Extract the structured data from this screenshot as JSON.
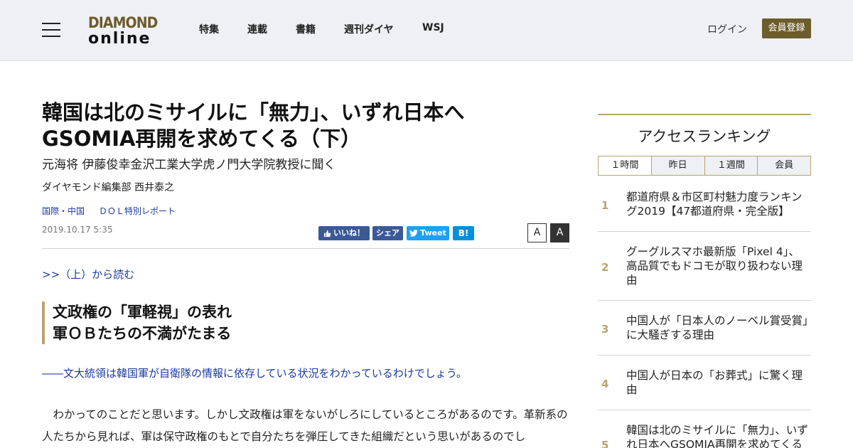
{
  "header": {
    "logo_top": "DIAMOND",
    "logo_bottom": "online",
    "nav": [
      "特集",
      "連載",
      "書籍",
      "週刊ダイヤ",
      "WSJ"
    ],
    "login": "ログイン",
    "register": "会員登録",
    "brand_color": "#6d5c2c"
  },
  "article": {
    "title_line1": "韓国は北のミサイルに「無力」、いずれ日本へ",
    "title_line2": "GSOMIA再開を求めてくる（下）",
    "subtitle": "元海将 伊藤俊幸金沢工業大学虎ノ門大学院教授に聞く",
    "author": "ダイヤモンド編集部 西井泰之",
    "categories": [
      "国際・中国",
      "ＤＯＬ特別レポート"
    ],
    "date": "2019.10.17 5:35",
    "share": {
      "like": "いいね！",
      "share": "シェア",
      "tweet": "Tweet",
      "hatena": "B!"
    },
    "font_small": "A",
    "font_large": "A",
    "prev_link": ">>（上）から読む",
    "section_line1": "文政権の「軍軽視」の表れ",
    "section_line2": "軍ＯＢたちの不満がたまる",
    "question": "――文大統領は韓国軍が自衛隊の情報に依存している状況をわかっているわけでしょう。",
    "body": "わかってのことだと思います。しかし文政権は軍をないがしろにしているところがあるのです。革新系の人たちから見れば、軍は保守政権のもとで自分たちを弾圧してきた組織だという思いがあるのでし"
  },
  "sidebar": {
    "title": "アクセスランキング",
    "tabs": [
      "１時間",
      "昨日",
      "１週間",
      "会員"
    ],
    "items": [
      {
        "rank": "1",
        "text": "都道府県＆市区町村魅力度ランキング2019【47都道府県・完全版】"
      },
      {
        "rank": "2",
        "text": "グーグルスマホ最新版「Pixel 4」、高品質でもドコモが取り扱わない理由"
      },
      {
        "rank": "3",
        "text": "中国人が「日本人のノーベル賞受賞」に大騒ぎする理由"
      },
      {
        "rank": "4",
        "text": "中国人が日本の「お葬式」に驚く理由"
      },
      {
        "rank": "5",
        "text": "韓国は北のミサイルに「無力」、いずれ日本へGSOMIA再開を求めてくる"
      }
    ]
  }
}
